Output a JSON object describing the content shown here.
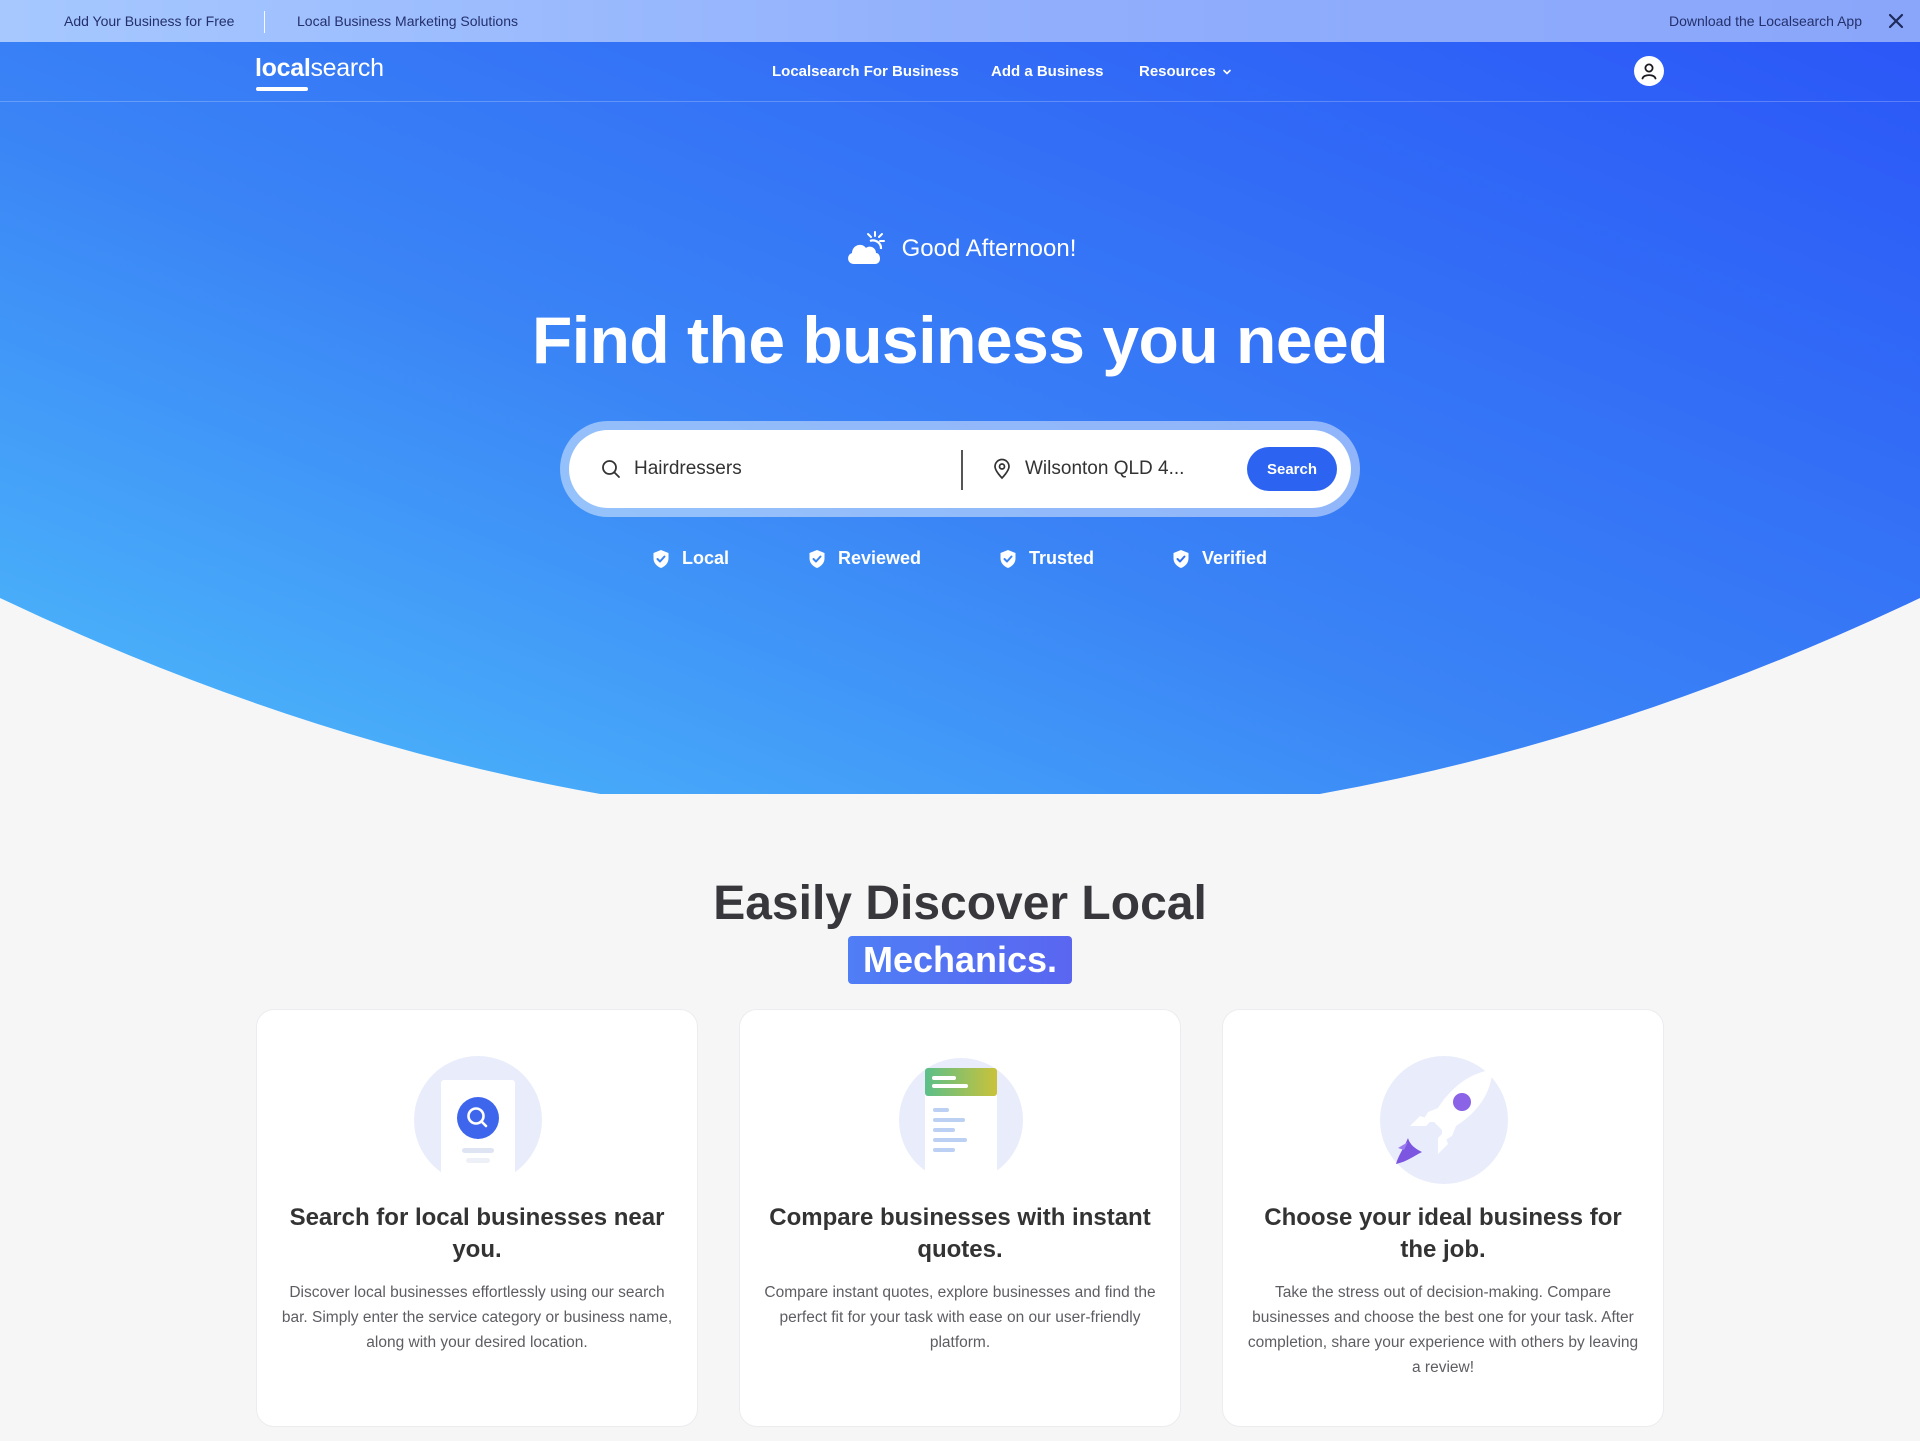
{
  "promo_bar": {
    "add_business": "Add Your Business for Free",
    "marketing": "Local Business Marketing Solutions",
    "download_app": "Download the Localsearch App",
    "close_icon": "close-icon"
  },
  "nav": {
    "logo_bold": "local",
    "logo_light": "search",
    "links": [
      "Localsearch For Business",
      "Add a Business",
      "Resources"
    ],
    "account_icon": "user-icon"
  },
  "hero": {
    "greeting": "Good Afternoon!",
    "greeting_icon": "cloud-sun-icon",
    "title": "Find the business you need",
    "search": {
      "query": "Hairdressers",
      "location": "Wilsonton QLD 4...",
      "button": "Search"
    },
    "badges": [
      "Local",
      "Reviewed",
      "Trusted",
      "Verified"
    ],
    "badge_icon": "shield-check-icon"
  },
  "discover": {
    "title": "Easily Discover Local",
    "highlight": "Mechanics.",
    "cards": [
      {
        "icon": "search-document-icon",
        "title": "Search for local businesses near you.",
        "text": "Discover local businesses effortlessly using our search bar. Simply enter the service category or business name, along with your desired location."
      },
      {
        "icon": "quote-list-icon",
        "title": "Compare businesses with instant quotes.",
        "text": "Compare instant quotes, explore businesses and find the perfect fit for your task with ease on our user-friendly platform."
      },
      {
        "icon": "rocket-icon",
        "title": "Choose your ideal business for the job.",
        "text": "Take the stress out of decision-making. Compare businesses and choose the best one for your task. After completion, share your experience with others by leaving a review!"
      }
    ]
  },
  "colors": {
    "brand_blue": "#2c63f0",
    "hero_light": "#52b8fb",
    "highlight": "#5a72f2"
  }
}
